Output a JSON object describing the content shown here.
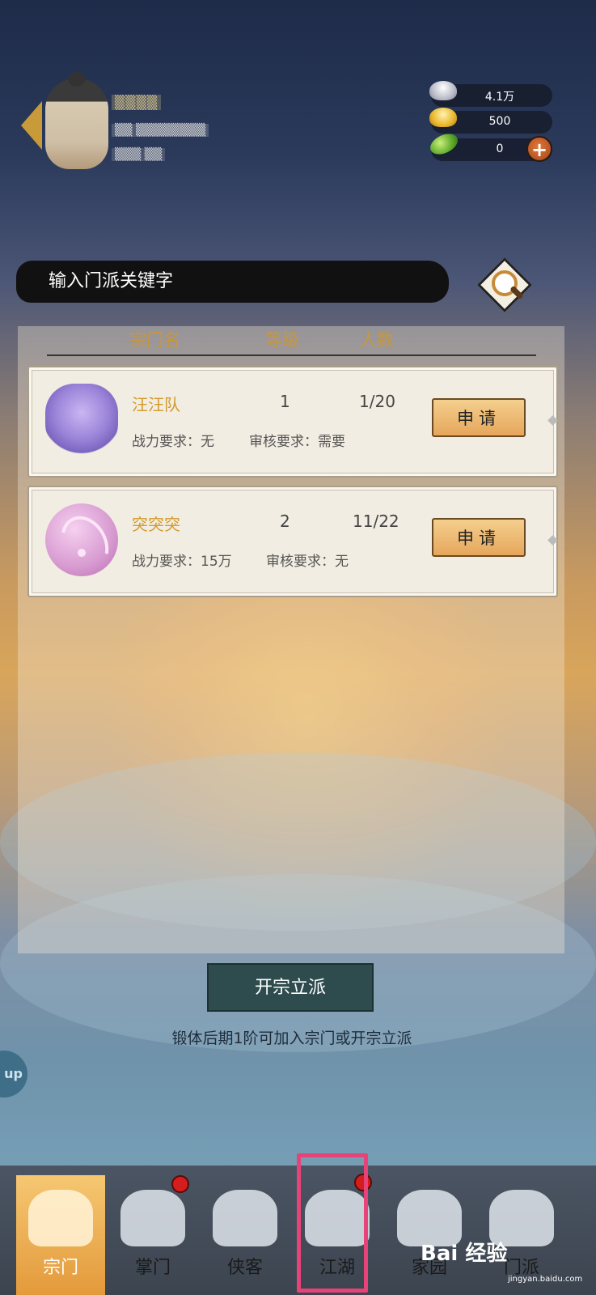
{
  "user": {
    "name": "▒▒▒▒",
    "info": "▒▒ ▒▒▒▒▒▒▒▒",
    "sub": "▒▒▒ ▒▒"
  },
  "currency": {
    "silver": "4.1万",
    "gold": "500",
    "jade": "0",
    "add": "+"
  },
  "search": {
    "placeholder": "输入门派关键字"
  },
  "table_headers": {
    "name": "宗门名",
    "level": "等级",
    "members": "人数"
  },
  "sects": [
    {
      "name": "汪汪队",
      "level": "1",
      "members": "1/20",
      "power_req": "战力要求：无",
      "review_req": "审核要求：需要",
      "apply_label": "申请"
    },
    {
      "name": "突突突",
      "level": "2",
      "members": "11/22",
      "power_req": "战力要求：15万",
      "review_req": "审核要求：无",
      "apply_label": "申请"
    }
  ],
  "found_button": "开宗立派",
  "found_hint": "锻体后期1阶可加入宗门或开宗立派",
  "float_button": "up",
  "nav": [
    {
      "label": "宗门",
      "active": true
    },
    {
      "label": "掌门",
      "badge": true
    },
    {
      "label": "侠客"
    },
    {
      "label": "江湖",
      "badge": true
    },
    {
      "label": "家园"
    },
    {
      "label": "门派"
    }
  ],
  "watermark": {
    "main": "Bai 经验",
    "sub": "jingyan.baidu.com"
  },
  "colors": {
    "accent_gold": "#c9973a",
    "apply_button": "#e6a65c",
    "highlight": "#e64379",
    "badge": "#d61d1d"
  }
}
